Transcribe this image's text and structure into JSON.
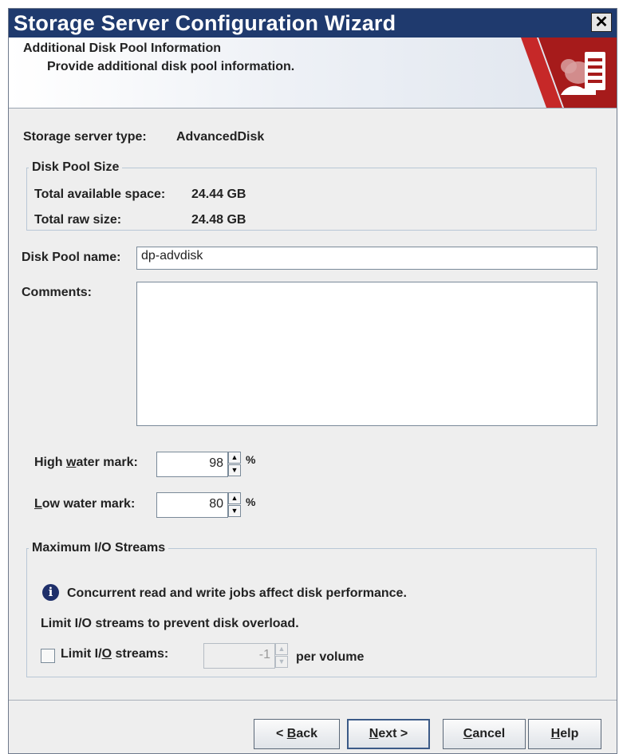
{
  "window": {
    "title": "Storage Server Configuration Wizard",
    "close_label": "✕"
  },
  "banner": {
    "title": "Additional Disk Pool Information",
    "subtitle": "Provide additional disk pool information."
  },
  "storage_server_type": {
    "label": "Storage server type:",
    "value": "AdvancedDisk"
  },
  "disk_pool_size": {
    "legend": "Disk Pool Size",
    "available_label": "Total available space:",
    "available_value": "24.44 GB",
    "raw_label": "Total raw size:",
    "raw_value": "24.48 GB"
  },
  "disk_pool_name": {
    "label": "Disk Pool name:",
    "value": "dp-advdisk"
  },
  "comments": {
    "label": "Comments:",
    "value": ""
  },
  "high_water_mark": {
    "label_pre": "High ",
    "label_mnemonic": "w",
    "label_post": "ater mark:",
    "value": "98",
    "unit": "%"
  },
  "low_water_mark": {
    "label_mnemonic": "L",
    "label_post": "ow water mark:",
    "value": "80",
    "unit": "%"
  },
  "max_io_streams": {
    "legend": "Maximum I/O Streams",
    "info_text": "Concurrent read and write jobs affect disk performance.",
    "hint_text": "Limit I/O streams to prevent disk overload.",
    "checkbox_label_pre": "Limit I/",
    "checkbox_label_mnemonic": "O",
    "checkbox_label_post": " streams:",
    "checked": false,
    "value": "-1",
    "unit": "per volume"
  },
  "buttons": {
    "back_pre": "< ",
    "back_mnemonic": "B",
    "back_post": "ack",
    "next_mnemonic": "N",
    "next_post": "ext >",
    "cancel_mnemonic": "C",
    "cancel_post": "ancel",
    "help_mnemonic": "H",
    "help_post": "elp"
  },
  "colors": {
    "title_bar": "#1f3a6e",
    "banner_accent": "#b71c1c",
    "info_icon": "#1e2f6a"
  }
}
